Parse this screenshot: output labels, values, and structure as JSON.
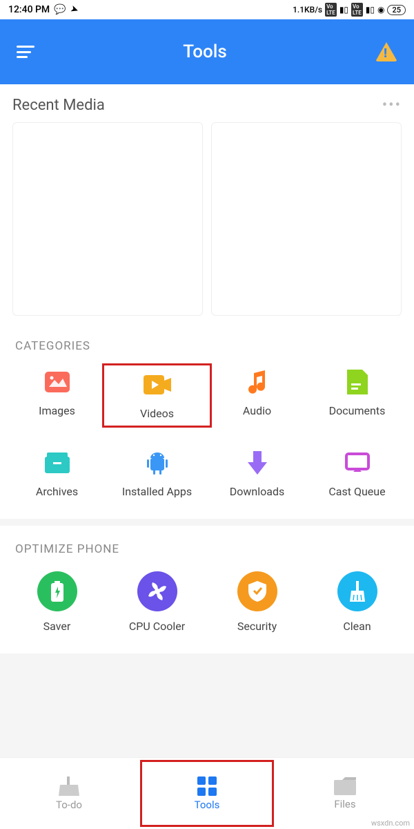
{
  "status": {
    "time": "12:40 PM",
    "net_speed": "1.1KB/s",
    "battery": "25"
  },
  "header": {
    "title": "Tools"
  },
  "recent": {
    "title": "Recent Media"
  },
  "categories": {
    "title": "CATEGORIES",
    "items": [
      {
        "label": "Images"
      },
      {
        "label": "Videos"
      },
      {
        "label": "Audio"
      },
      {
        "label": "Documents"
      },
      {
        "label": "Archives"
      },
      {
        "label": "Installed Apps"
      },
      {
        "label": "Downloads"
      },
      {
        "label": "Cast Queue"
      }
    ]
  },
  "optimize": {
    "title": "OPTIMIZE PHONE",
    "items": [
      {
        "label": "Saver"
      },
      {
        "label": "CPU Cooler"
      },
      {
        "label": "Security"
      },
      {
        "label": "Clean"
      }
    ]
  },
  "nav": {
    "items": [
      {
        "label": "To-do"
      },
      {
        "label": "Tools"
      },
      {
        "label": "Files"
      }
    ]
  },
  "watermark": "wsxdn.com"
}
